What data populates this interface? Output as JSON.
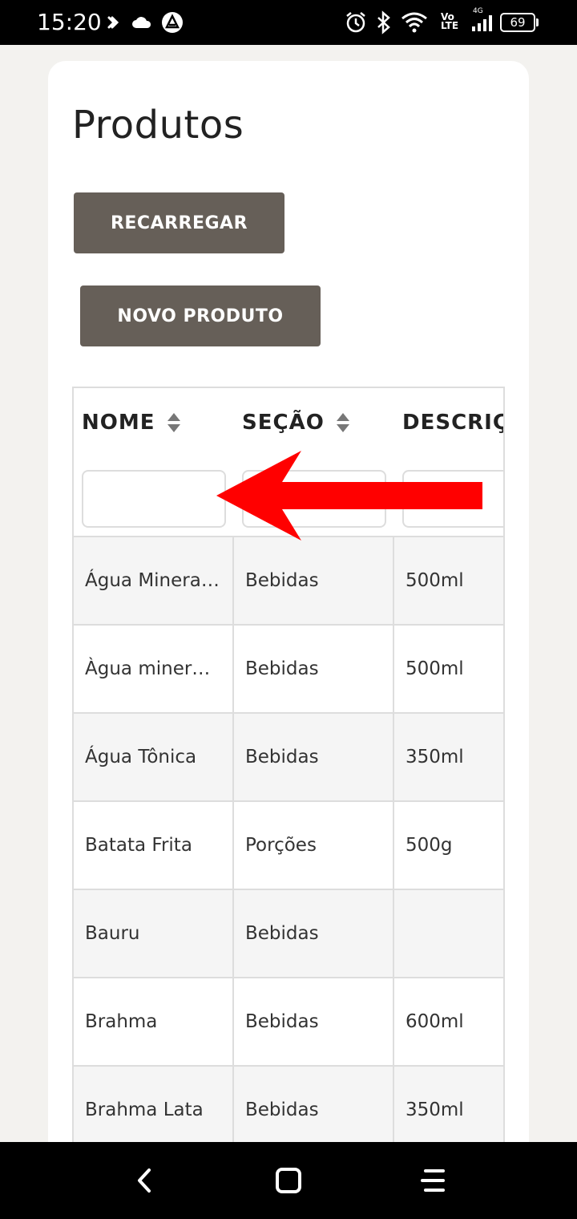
{
  "status_bar": {
    "time": "15:20",
    "network_top": "4G",
    "volte_line1": "Vo",
    "volte_line2": "LTE",
    "battery": "69",
    "icons": [
      "shazam-icon",
      "cloud-icon",
      "app-icon",
      "alarm-icon",
      "bluetooth-icon",
      "wifi-icon",
      "signal-icon",
      "battery-icon"
    ]
  },
  "page": {
    "title": "Produtos",
    "reload_label": "RECARREGAR",
    "new_product_label": "NOVO PRODUTO"
  },
  "table": {
    "columns": [
      {
        "label": "NOME",
        "sortable": true
      },
      {
        "label": "SEÇÃO",
        "sortable": true
      },
      {
        "label": "DESCRIÇ",
        "sortable": false
      }
    ],
    "rows": [
      {
        "nome": "Água Minera…",
        "secao": "Bebidas",
        "descricao": "500ml"
      },
      {
        "nome": "Àgua miner…",
        "secao": "Bebidas",
        "descricao": "500ml"
      },
      {
        "nome": "Água Tônica",
        "secao": "Bebidas",
        "descricao": "350ml"
      },
      {
        "nome": "Batata Frita",
        "secao": "Porções",
        "descricao": "500g"
      },
      {
        "nome": "Bauru",
        "secao": "Bebidas",
        "descricao": ""
      },
      {
        "nome": "Brahma",
        "secao": "Bebidas",
        "descricao": "600ml"
      },
      {
        "nome": "Brahma Lata",
        "secao": "Bebidas",
        "descricao": "350ml"
      }
    ]
  },
  "annotation": {
    "icon": "red-arrow-left-icon",
    "color": "#ff0000"
  },
  "nav_bar": {
    "icons": [
      "back-icon",
      "home-icon",
      "menu-icon"
    ]
  },
  "colors": {
    "button": "#665f58",
    "background": "#f3f2ef",
    "card": "#ffffff",
    "border": "#dddddd"
  }
}
